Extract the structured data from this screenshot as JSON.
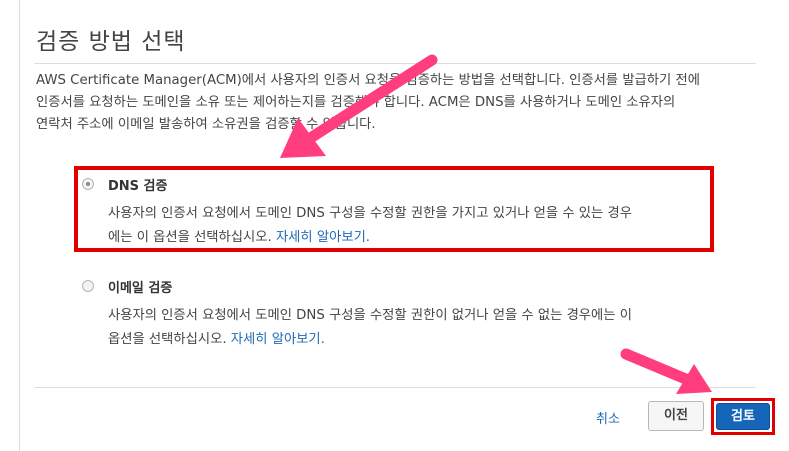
{
  "header": {
    "title": "검증 방법 선택"
  },
  "intro": {
    "lines": [
      "AWS Certificate Manager(ACM)에서 사용자의 인증서 요청을 검증하는 방법을 선택합니다. 인증서를 발급하기 전에",
      "인증서를 요청하는 도메인을 소유 또는 제어하는지를 검증해야 합니다. ACM은 DNS를 사용하거나 도메인 소유자의",
      "연락처 주소에 이메일 발송하여 소유권을 검증할 수 있습니다."
    ]
  },
  "options": [
    {
      "title": "DNS 검증",
      "selected": true,
      "desc_line1": "사용자의 인증서 요청에서 도메인 DNS 구성을 수정할 권한을 가지고 있거나 얻을 수 있는 경우",
      "desc_line2": "에는 이 옵션을 선택하십시오.",
      "link": "자세히 알아보기."
    },
    {
      "title": "이메일 검증",
      "selected": false,
      "desc_line1": "사용자의 인증서 요청에서 도메인 DNS 구성을 수정할 권한이 없거나 얻을 수 없는 경우에는 이",
      "desc_line2": "옵션을 선택하십시오.",
      "link": "자세히 알아보기."
    }
  ],
  "footer": {
    "cancel_label": "취소",
    "previous_label": "이전",
    "review_label": "검토"
  },
  "colors": {
    "highlight": "#e00000",
    "annotation_arrow": "#ff3d7f",
    "primary_button": "#1566b8",
    "link": "#1f6bb5"
  }
}
